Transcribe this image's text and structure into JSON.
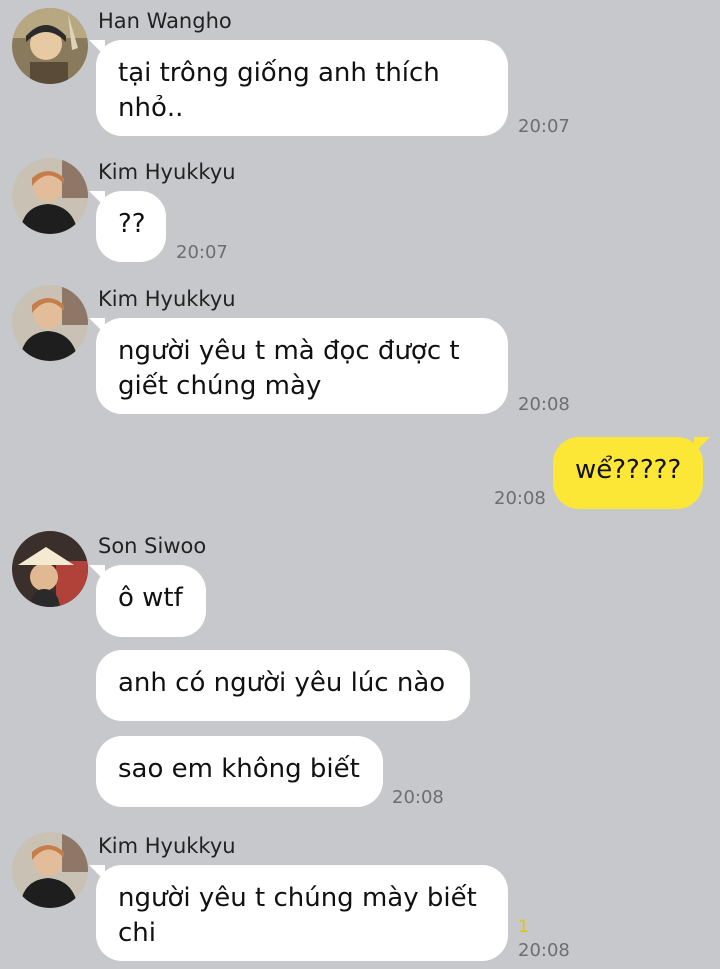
{
  "colors": {
    "background": "#c6c8cb",
    "incoming_bubble": "#ffffff",
    "outgoing_bubble": "#fde736",
    "timestamp": "#6c6e72",
    "unread_badge": "#e5c400"
  },
  "messages": [
    {
      "sender": "Han Wangho",
      "avatar": "profile-photo-icon",
      "lines": [
        "tại trông giống anh thích",
        "nhỏ.."
      ],
      "time": "20:07"
    },
    {
      "sender": "Kim Hyukkyu",
      "avatar": "profile-photo-icon",
      "lines": [
        "??"
      ],
      "time": "20:07"
    },
    {
      "sender": "Kim Hyukkyu",
      "avatar": "profile-photo-icon",
      "lines": [
        "người yêu t mà đọc được t",
        "giết chúng mày"
      ],
      "time": "20:08"
    },
    {
      "sender": "me",
      "lines": [
        "wể?????"
      ],
      "time": "20:08"
    },
    {
      "sender": "Son Siwoo",
      "avatar": "profile-photo-icon",
      "bubbles": [
        "ô wtf",
        "anh có người yêu lúc nào",
        "sao em không biết"
      ],
      "time": "20:08"
    },
    {
      "sender": "Kim Hyukkyu",
      "avatar": "profile-photo-icon",
      "lines": [
        "người yêu t chúng mày biết",
        "chi"
      ],
      "unread": "1",
      "time": "20:08"
    }
  ]
}
